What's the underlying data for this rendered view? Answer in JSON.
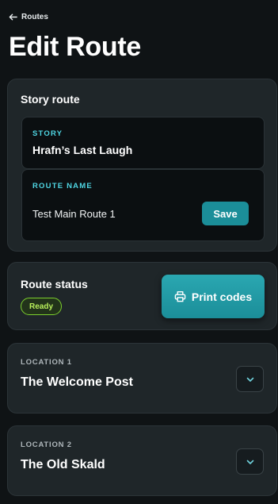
{
  "nav": {
    "back_label": "Routes",
    "back_icon": "arrow-left-icon"
  },
  "page": {
    "title": "Edit Route"
  },
  "story_card": {
    "heading": "Story route",
    "story_label": "STORY",
    "story_value": "Hrafn’s Last Laugh",
    "route_name_label": "ROUTE NAME",
    "route_name_value": "Test Main Route 1",
    "save_label": "Save"
  },
  "status_card": {
    "heading": "Route status",
    "badge": "Ready",
    "print_label": "Print codes",
    "print_icon": "printer-icon"
  },
  "locations": [
    {
      "label": "LOCATION 1",
      "name": "The Welcome Post"
    },
    {
      "label": "LOCATION 2",
      "name": "The Old Skald"
    }
  ],
  "colors": {
    "accent": "#1b8e99",
    "label_accent": "#4fd6e3",
    "ready_badge": "#7ccf2e",
    "background": "#0f1315",
    "card": "#1f2629"
  }
}
